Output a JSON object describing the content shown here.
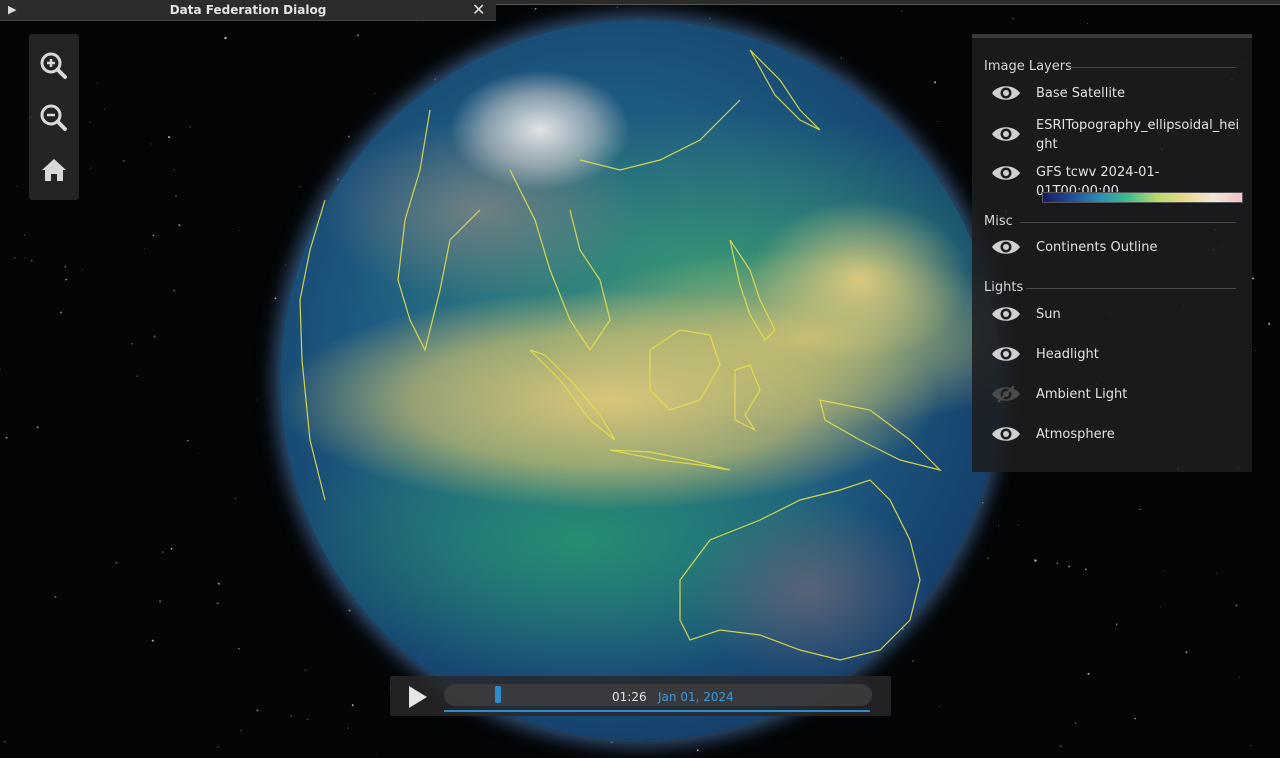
{
  "dialog": {
    "title": "Data Federation Dialog",
    "expand_icon": "play-triangle-icon",
    "close_icon": "close-icon",
    "close_label": "✕"
  },
  "toolbar": {
    "buttons": [
      {
        "name": "zoom-in-icon"
      },
      {
        "name": "zoom-out-icon"
      },
      {
        "name": "home-icon"
      }
    ]
  },
  "layers_panel": {
    "sections": [
      {
        "title": "Image Layers",
        "items": [
          {
            "label": "Base Satellite",
            "visible": true
          },
          {
            "label": "ESRITopography_ellipsoidal_height",
            "visible": true
          },
          {
            "label": "GFS tcwv 2024-01-01T00:00:00",
            "visible": true
          }
        ]
      },
      {
        "title": "Misc",
        "items": [
          {
            "label": "Continents Outline",
            "visible": true
          }
        ]
      },
      {
        "title": "Lights",
        "items": [
          {
            "label": "Sun",
            "visible": true
          },
          {
            "label": "Headlight",
            "visible": true
          },
          {
            "label": "Ambient Light",
            "visible": false
          },
          {
            "label": "Atmosphere",
            "visible": true
          }
        ]
      }
    ],
    "colorbar_colors": [
      "#1a1a5e",
      "#1f4f9a",
      "#2a8fb5",
      "#3fbf8f",
      "#b9d96a",
      "#e8d98a",
      "#f0e8d8",
      "#f4c0c8"
    ]
  },
  "timeline": {
    "time": "01:26",
    "date": "Jan 01, 2024",
    "position_fraction": 0.12,
    "accent_color": "#2f8ccb"
  }
}
